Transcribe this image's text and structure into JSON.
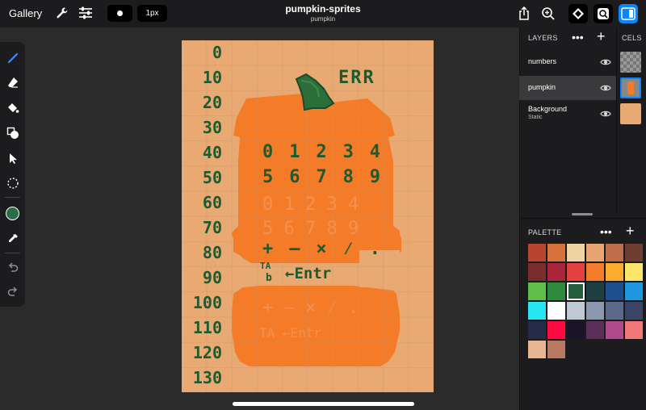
{
  "topbar": {
    "gallery_label": "Gallery",
    "brush_size_label": "1px",
    "document_title": "pumpkin-sprites",
    "document_subtitle": "pumpkin"
  },
  "canvas": {
    "background": "#e8a972",
    "row_labels": [
      "0",
      "10",
      "20",
      "30",
      "40",
      "50",
      "60",
      "70",
      "80",
      "90",
      "100",
      "110",
      "120",
      "130"
    ],
    "err_text": "ERR",
    "digits_row1": [
      "0",
      "1",
      "2",
      "3",
      "4"
    ],
    "digits_row2": [
      "5",
      "6",
      "7",
      "8",
      "9"
    ],
    "ops_row": [
      "+",
      "—",
      "×",
      "⁄",
      "."
    ],
    "tab_label_top": "TA",
    "tab_label_bottom": "b",
    "enter_text": "←Entr",
    "pumpkin_color": "#f47b28",
    "stem_color": "#2c6e3a",
    "text_color": "#1e5a30"
  },
  "layers": {
    "header": "LAYERS",
    "cels_header": "CELS",
    "items": [
      {
        "name": "numbers",
        "sub": "",
        "selected": false
      },
      {
        "name": "pumpkin",
        "sub": "",
        "selected": true
      },
      {
        "name": "Background",
        "sub": "Static",
        "selected": false
      }
    ]
  },
  "palette": {
    "header": "PALETTE",
    "selected_index": 14,
    "colors": [
      "#b8462e",
      "#d9713a",
      "#efd3a2",
      "#e6a571",
      "#bf6e4c",
      "#6e3e33",
      "#7a2d2d",
      "#a8253a",
      "#e3423f",
      "#f37d2c",
      "#fbac2e",
      "#fde76a",
      "#5ec04a",
      "#2e8b3e",
      "#235d3c",
      "#1e4040",
      "#1d4e8e",
      "#1e96e0",
      "#27e6f2",
      "#ffffff",
      "#c0c8d6",
      "#8a98b0",
      "#5a6a8a",
      "#3a4466",
      "#262c48",
      "#ff0a40",
      "#1a1426",
      "#5a3058",
      "#b04a8a",
      "#f07878",
      "#e8b690",
      "#b87a60"
    ]
  }
}
